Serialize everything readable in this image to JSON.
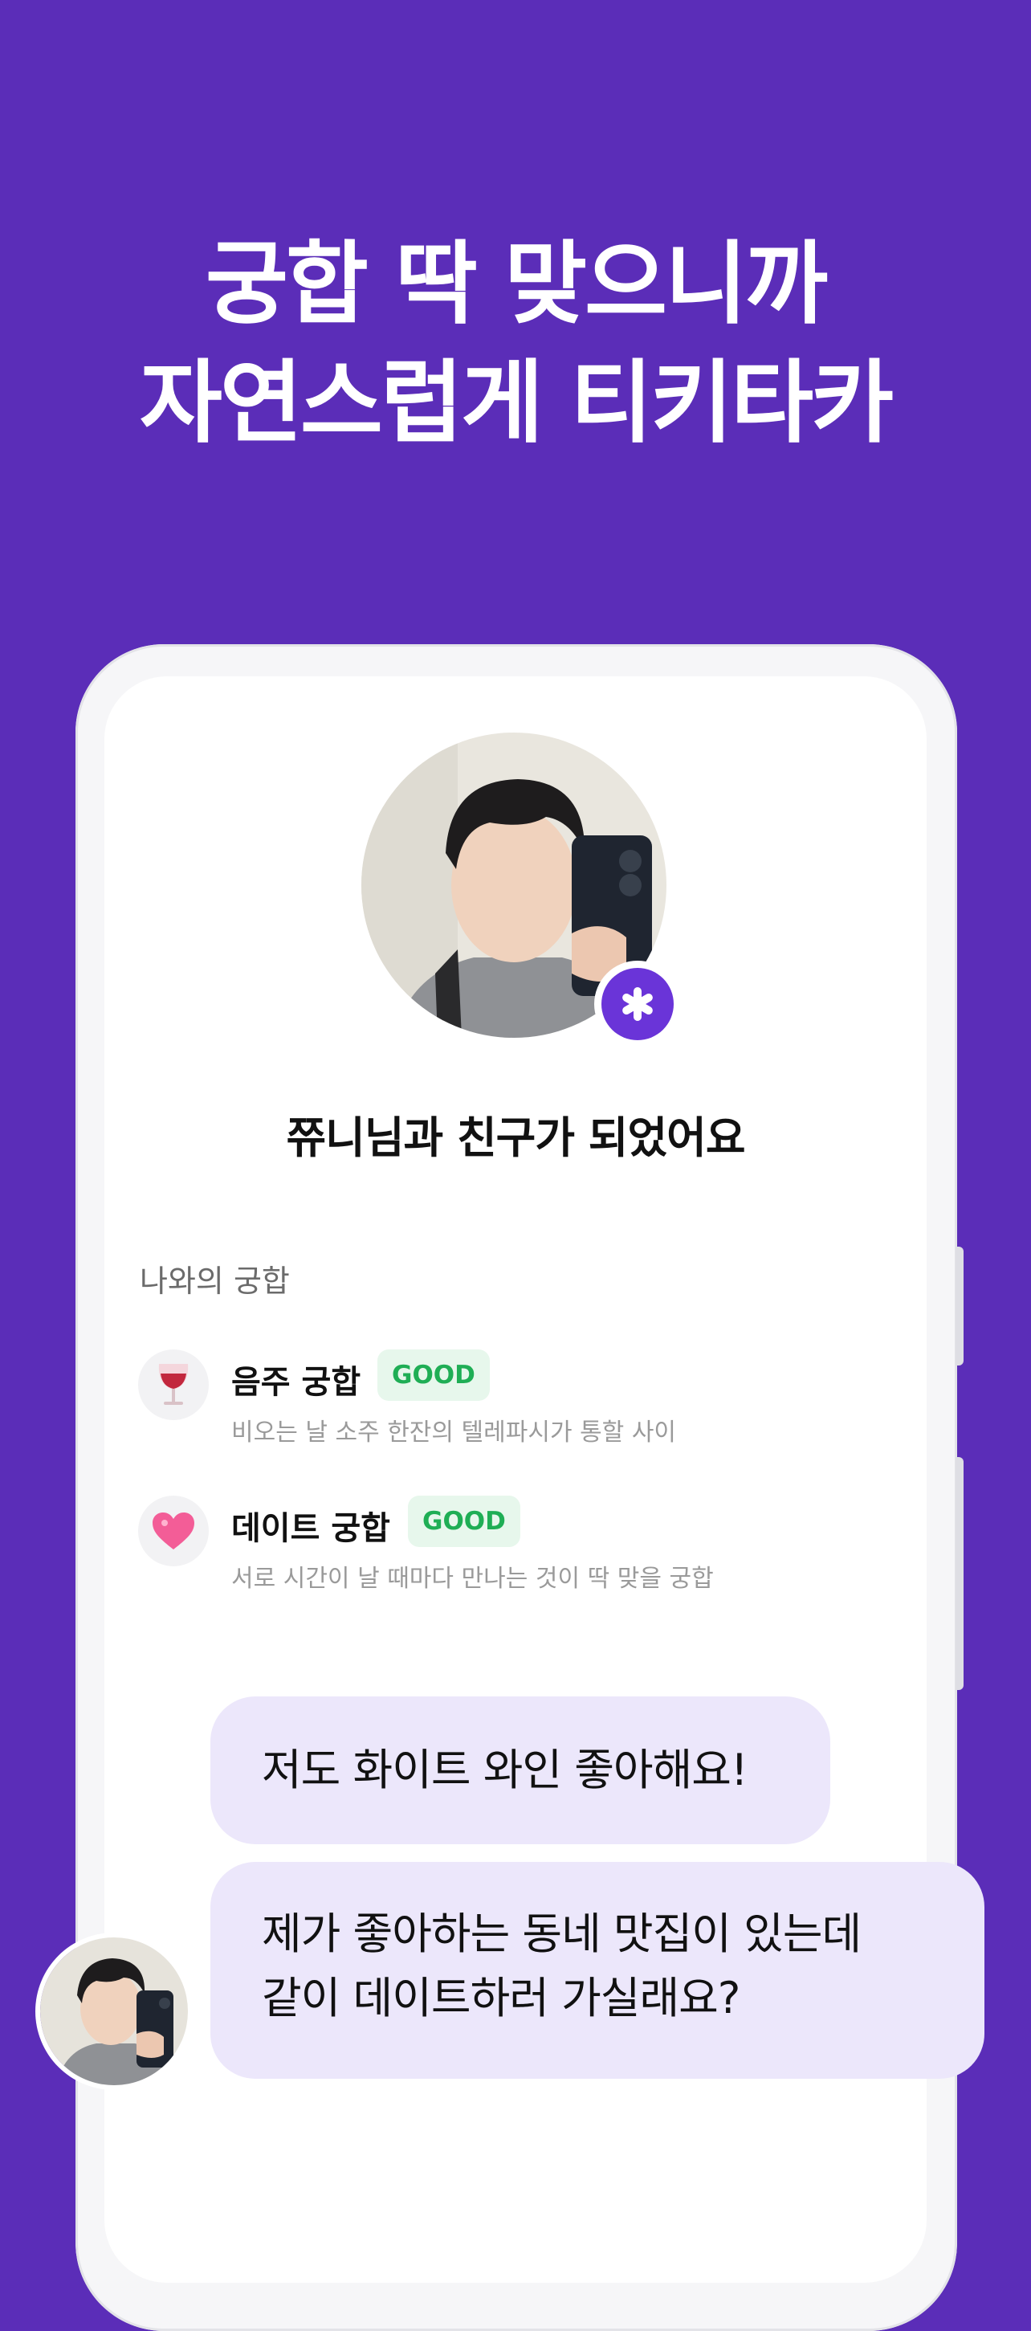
{
  "headline": {
    "line1": "궁합 딱 맞으니까",
    "line2": "자연스럽게 티키타카"
  },
  "profile": {
    "friend_message": "쮸니님과 친구가 되었어요",
    "badge_icon": "star-badge-icon"
  },
  "compatibility": {
    "section_label": "나와의 궁합",
    "items": [
      {
        "icon": "wine-glass-icon",
        "title": "음주 궁합",
        "rating": "GOOD",
        "description": "비오는 날 소주 한잔의 텔레파시가 통할 사이"
      },
      {
        "icon": "heart-icon",
        "title": "데이트 궁합",
        "rating": "GOOD",
        "description": "서로 시간이 날 때마다 만나는 것이 딱 맞을 궁합"
      }
    ]
  },
  "chat": {
    "messages": [
      {
        "lines": [
          "저도 화이트 와인 좋아해요!"
        ]
      },
      {
        "lines": [
          "제가 좋아하는 동네 맛집이 있는데",
          "같이 데이트하러 가실래요?"
        ]
      }
    ]
  },
  "colors": {
    "background": "#5b2db8",
    "accent": "#6a34d8",
    "bubble": "#ece7fb",
    "good_text": "#1fae55",
    "good_bg": "#e7f7ec"
  }
}
